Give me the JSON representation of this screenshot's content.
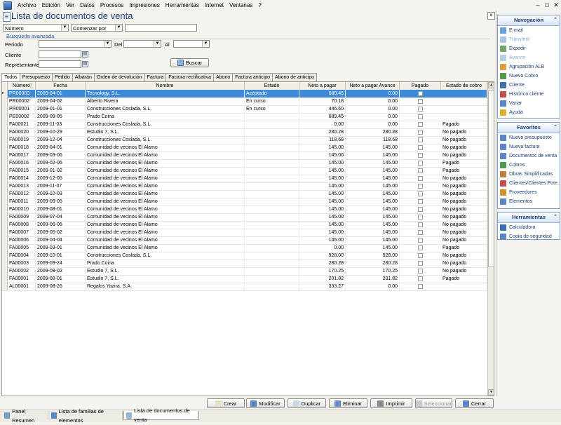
{
  "menu": [
    "Archivo",
    "Edición",
    "Ver",
    "Datos",
    "Procesos",
    "Impresiones",
    "Herramientas",
    "Internet",
    "Ventanas",
    "?"
  ],
  "window_controls": [
    "‒",
    "□",
    "✕"
  ],
  "page_title": "Lista de documentos de venta",
  "filters": {
    "field_combo": "Número",
    "match_combo": "Comenzar por",
    "search_value": "",
    "advanced_label": "Búsqueda avanzada",
    "periodo_label": "Periodo",
    "del_label": "Del",
    "al_label": "Al",
    "cliente_label": "Cliente",
    "representante_label": "Representante",
    "buscar_label": "Buscar"
  },
  "tabs": [
    "Todos",
    "Presupuesto",
    "Pedido",
    "Albarán",
    "Orden de devolución",
    "Factura",
    "Factura rectificativa",
    "Abono",
    "Factura anticipo",
    "Abono de anticipo"
  ],
  "columns": [
    "Número",
    "Fecha",
    "Nombre",
    "Estado",
    "Neto a pagar",
    "Neto a pagar Avance",
    "Pagado",
    "Estado de cobro"
  ],
  "rows": [
    {
      "num": "PR00003",
      "fecha": "2009-04-01",
      "nombre": "Tecnology, S.L.",
      "estado": "Aceptado",
      "neto": "689.45",
      "avance": "0.00",
      "cobro": ""
    },
    {
      "num": "PR00002",
      "fecha": "2009-04-02",
      "nombre": "Alberto Rivera",
      "estado": "En curso",
      "neto": "70.18",
      "avance": "0.00",
      "cobro": ""
    },
    {
      "num": "PR00001",
      "fecha": "2009-01-01",
      "nombre": "Construcciones Coslada, S.L.",
      "estado": "En curso",
      "neto": "446.60",
      "avance": "0.00",
      "cobro": ""
    },
    {
      "num": "PE00002",
      "fecha": "2009-09-05",
      "nombre": "Prado Coina",
      "estado": "",
      "neto": "689.45",
      "avance": "0.00",
      "cobro": ""
    },
    {
      "num": "FA00021",
      "fecha": "2009-11-03",
      "nombre": "Construcciones Coslada, S.L.",
      "estado": "",
      "neto": "0.00",
      "avance": "0.00",
      "cobro": "Pagado"
    },
    {
      "num": "FA00020",
      "fecha": "2009-10-29",
      "nombre": "Estudio 7, S.L.",
      "estado": "",
      "neto": "280.28",
      "avance": "280.28",
      "cobro": "No pagado"
    },
    {
      "num": "FA00019",
      "fecha": "2009-12-04",
      "nombre": "Construcciones Coslada, S.L.",
      "estado": "",
      "neto": "118.68",
      "avance": "118.68",
      "cobro": "No pagado"
    },
    {
      "num": "FA00018",
      "fecha": "2009-04-01",
      "nombre": "Comunidad de vecinos El Alamo",
      "estado": "",
      "neto": "145.00",
      "avance": "145.00",
      "cobro": "No pagado"
    },
    {
      "num": "FA00017",
      "fecha": "2009-03-06",
      "nombre": "Comunidad de vecinos El Alamo",
      "estado": "",
      "neto": "145.00",
      "avance": "145.00",
      "cobro": "No pagado"
    },
    {
      "num": "FA00016",
      "fecha": "2009-02-06",
      "nombre": "Comunidad de vecinos El Alamo",
      "estado": "",
      "neto": "145.00",
      "avance": "145.00",
      "cobro": "Pagado"
    },
    {
      "num": "FA00015",
      "fecha": "2009-01-02",
      "nombre": "Comunidad de vecinos El Alamo",
      "estado": "",
      "neto": "145.00",
      "avance": "145.00",
      "cobro": "Pagado"
    },
    {
      "num": "FA00014",
      "fecha": "2009-12-05",
      "nombre": "Comunidad de vecinos El Alamo",
      "estado": "",
      "neto": "145.00",
      "avance": "145.00",
      "cobro": "No pagado"
    },
    {
      "num": "FA00013",
      "fecha": "2009-11-07",
      "nombre": "Comunidad de vecinos El Alamo",
      "estado": "",
      "neto": "145.00",
      "avance": "145.00",
      "cobro": "No pagado"
    },
    {
      "num": "FA00012",
      "fecha": "2009-10-03",
      "nombre": "Comunidad de vecinos El Alamo",
      "estado": "",
      "neto": "145.00",
      "avance": "145.00",
      "cobro": "No pagado"
    },
    {
      "num": "FA00011",
      "fecha": "2009-09-05",
      "nombre": "Comunidad de vecinos El Alamo",
      "estado": "",
      "neto": "145.00",
      "avance": "145.00",
      "cobro": "No pagado"
    },
    {
      "num": "FA00010",
      "fecha": "2009-08-01",
      "nombre": "Comunidad de vecinos El Alamo",
      "estado": "",
      "neto": "145.00",
      "avance": "145.00",
      "cobro": "No pagado"
    },
    {
      "num": "FA00009",
      "fecha": "2009-07-04",
      "nombre": "Comunidad de vecinos El Alamo",
      "estado": "",
      "neto": "145.00",
      "avance": "145.00",
      "cobro": "No pagado"
    },
    {
      "num": "FA00008",
      "fecha": "2009-06-06",
      "nombre": "Comunidad de vecinos El Alamo",
      "estado": "",
      "neto": "145.00",
      "avance": "145.00",
      "cobro": "No pagado"
    },
    {
      "num": "FA00007",
      "fecha": "2009-05-02",
      "nombre": "Comunidad de vecinos El Alamo",
      "estado": "",
      "neto": "145.00",
      "avance": "145.00",
      "cobro": "No pagado"
    },
    {
      "num": "FA00006",
      "fecha": "2009-04-04",
      "nombre": "Comunidad de vecinos El Alamo",
      "estado": "",
      "neto": "145.00",
      "avance": "145.00",
      "cobro": "No pagado"
    },
    {
      "num": "FA00005",
      "fecha": "2009-03-01",
      "nombre": "Comunidad de vecinos El Alamo",
      "estado": "",
      "neto": "0.00",
      "avance": "145.00",
      "cobro": "Pagado"
    },
    {
      "num": "FA00004",
      "fecha": "2009-10-01",
      "nombre": "Construcciones Coslada, S.L.",
      "estado": "",
      "neto": "928.00",
      "avance": "928.00",
      "cobro": "No pagado"
    },
    {
      "num": "FA00003",
      "fecha": "2009-09-24",
      "nombre": "Prado Coina",
      "estado": "",
      "neto": "280.28",
      "avance": "280.28",
      "cobro": "No pagado"
    },
    {
      "num": "FA00002",
      "fecha": "2009-09-02",
      "nombre": "Estudio 7, S.L.",
      "estado": "",
      "neto": "170.25",
      "avance": "170.25",
      "cobro": "No pagado"
    },
    {
      "num": "FA00001",
      "fecha": "2009-08-01",
      "nombre": "Estudio 7, S.L.",
      "estado": "",
      "neto": "201.82",
      "avance": "201.82",
      "cobro": "Pagado"
    },
    {
      "num": "AL00001",
      "fecha": "2009-08-26",
      "nombre": "Regalos Yazira, S.A",
      "estado": "",
      "neto": "333.27",
      "avance": "0.00",
      "cobro": ""
    }
  ],
  "actions": [
    {
      "label": "Crear",
      "icon": "new-document-icon",
      "color": "#e8e3c8",
      "enabled": true
    },
    {
      "label": "Modificar",
      "icon": "edit-icon",
      "color": "#5a86c8",
      "enabled": true
    },
    {
      "label": "Duplicar",
      "icon": "duplicate-icon",
      "color": "#c8d6ea",
      "enabled": true
    },
    {
      "label": "Eliminar",
      "icon": "delete-icon",
      "color": "#6a8fc4",
      "enabled": true
    },
    {
      "label": "Imprimir",
      "icon": "print-icon",
      "color": "#8a8a8a",
      "enabled": true
    },
    {
      "label": "Seleccionar",
      "icon": "select-icon",
      "color": "#c8c8c8",
      "enabled": false
    },
    {
      "label": "Cerrar",
      "icon": "close-icon",
      "color": "#5a86c8",
      "enabled": true
    }
  ],
  "doc_tabs": [
    {
      "label": "Panel Resumen",
      "icon": "summary-icon"
    },
    {
      "label": "Lista de familias de elementos",
      "icon": "families-icon"
    },
    {
      "label": "Lista de documentos de venta",
      "icon": "documents-icon"
    }
  ],
  "navegacion": {
    "title": "Navegación",
    "items": [
      {
        "label": "E-mail",
        "icon": "email-icon",
        "color": "#6a9fd8",
        "enabled": true
      },
      {
        "label": "Transferir",
        "icon": "transfer-icon",
        "color": "#a9c4e6",
        "enabled": false
      },
      {
        "label": "Expedir",
        "icon": "ship-icon",
        "color": "#6fa86a",
        "enabled": true
      },
      {
        "label": "Avance",
        "icon": "advance-icon",
        "color": "#b7cde8",
        "enabled": false
      },
      {
        "label": "Agrupación ALB",
        "icon": "group-icon",
        "color": "#e0a040",
        "enabled": true
      },
      {
        "label": "Nuevo Cobro",
        "icon": "payment-icon",
        "color": "#4f9a4f",
        "enabled": true
      },
      {
        "label": "Cliente",
        "icon": "client-icon",
        "color": "#3a6fb0",
        "enabled": true
      },
      {
        "label": "Histórico cliente",
        "icon": "history-icon",
        "color": "#c05050",
        "enabled": true
      },
      {
        "label": "Variar",
        "icon": "vary-icon",
        "color": "#5a86c8",
        "enabled": true
      },
      {
        "label": "Ayuda",
        "icon": "help-icon",
        "color": "#e0b030",
        "enabled": true
      }
    ]
  },
  "favoritos": {
    "title": "Favoritos",
    "items": [
      {
        "label": "Nuevo presupuesto",
        "icon": "quote-icon",
        "color": "#5a86c8"
      },
      {
        "label": "Nueva factura",
        "icon": "invoice-icon",
        "color": "#5a86c8"
      },
      {
        "label": "Documentos de venta",
        "icon": "sales-docs-icon",
        "color": "#5a86c8"
      },
      {
        "label": "Cobros",
        "icon": "collections-icon",
        "color": "#4f9a4f"
      },
      {
        "label": "Obras Simplificadas",
        "icon": "works-icon",
        "color": "#c08040"
      },
      {
        "label": "Clientes/Clientes Pote...",
        "icon": "clients-icon",
        "color": "#c05050"
      },
      {
        "label": "Proveedores",
        "icon": "suppliers-icon",
        "color": "#d09030"
      },
      {
        "label": "Elementos",
        "icon": "elements-icon",
        "color": "#5a86c8"
      }
    ]
  },
  "herramientas": {
    "title": "Herramientas",
    "items": [
      {
        "label": "Calculadora",
        "icon": "calculator-icon",
        "color": "#3a6fb0"
      },
      {
        "label": "Copia de seguridad",
        "icon": "backup-icon",
        "color": "#5a86c8"
      }
    ]
  }
}
